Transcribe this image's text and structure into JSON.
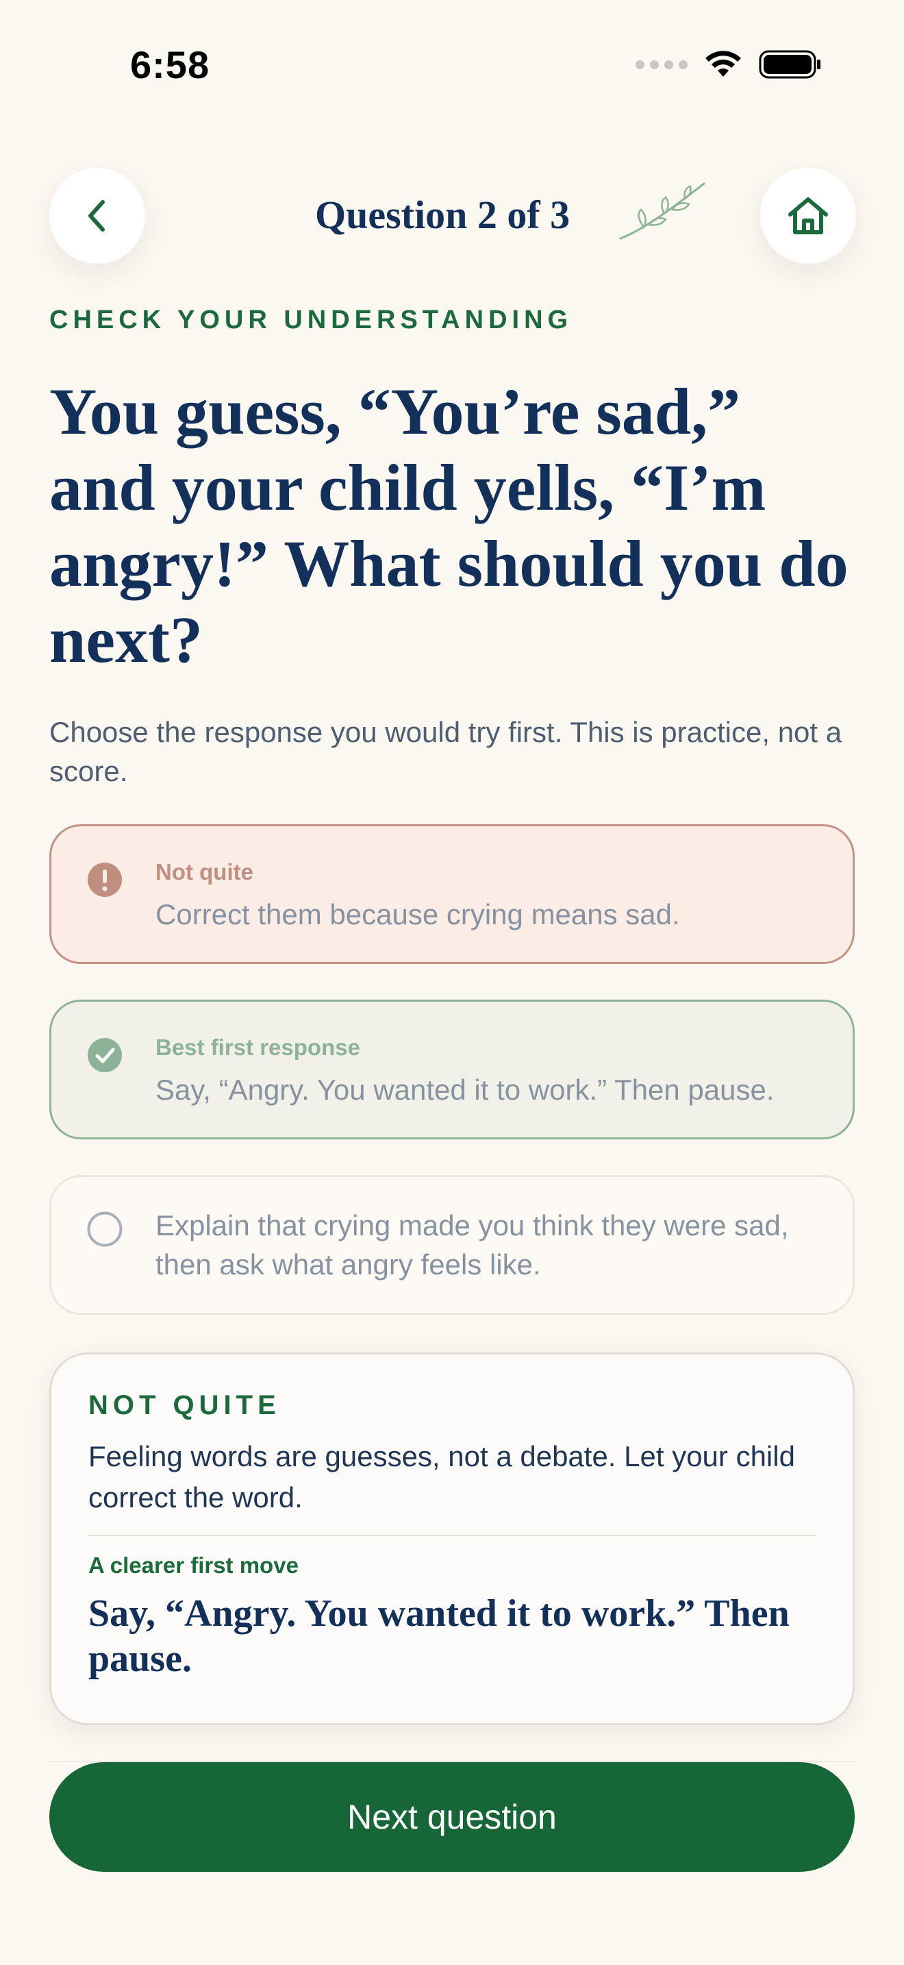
{
  "status_bar": {
    "time": "6:58"
  },
  "header": {
    "title": "Question 2 of 3",
    "back_icon": "chevron-left-icon",
    "home_icon": "home-icon",
    "decoration_icon": "leaf-sprig-icon"
  },
  "kicker": "CHECK YOUR UNDERSTANDING",
  "question": "You guess, “You’re sad,” and your child yells, “I’m angry!” What should you do next?",
  "subtitle": "Choose the response you would try first. This is practice, not a score.",
  "options": [
    {
      "state": "incorrect",
      "tag": "Not quite",
      "text": "Correct them because crying means sad.",
      "icon": "alert-icon"
    },
    {
      "state": "correct",
      "tag": "Best first response",
      "text": "Say, “Angry. You wanted it to work.” Then pause.",
      "icon": "check-circle-icon"
    },
    {
      "state": "unselected",
      "tag": "",
      "text": "Explain that crying made you think they were sad, then ask what angry feels like.",
      "icon": "radio-empty-icon"
    }
  ],
  "feedback": {
    "kicker": "NOT QUITE",
    "body": "Feeling words are guesses, not a debate. Let your child correct the word.",
    "label": "A clearer first move",
    "quote": "Say, “Angry. You wanted it to work.” Then pause."
  },
  "next_button": {
    "label": "Next question"
  },
  "colors": {
    "background": "#FBF7F1",
    "primary_green": "#176637",
    "navy": "#12305A",
    "error_border": "#C49383",
    "success_border": "#8DB495"
  }
}
